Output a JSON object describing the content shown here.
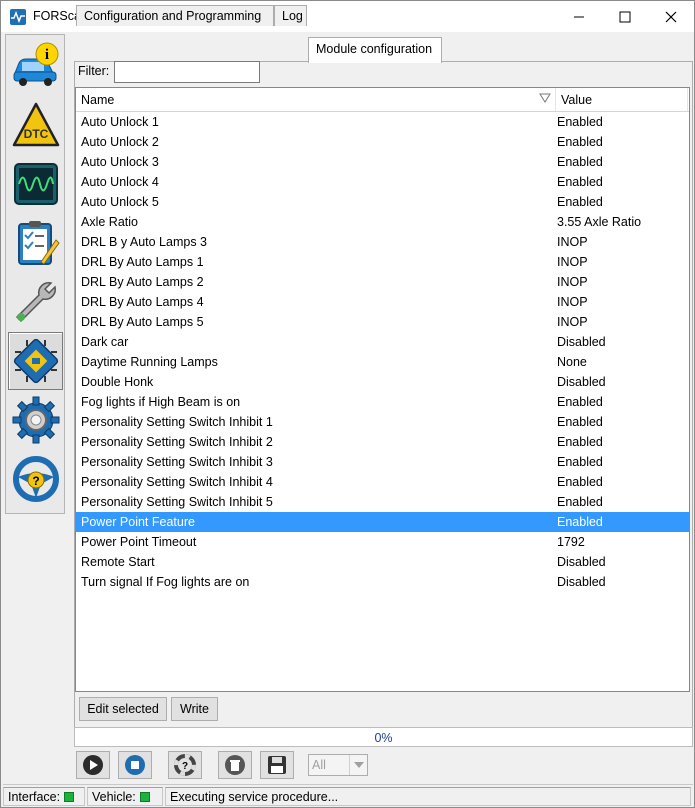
{
  "window": {
    "title": "FORScan",
    "controls": {
      "minimize": "—",
      "maximize": "☐",
      "close": "✕"
    }
  },
  "sidebar": {
    "items": [
      {
        "icon": "vehicle-info-icon"
      },
      {
        "icon": "dtc-icon",
        "text": "DTC"
      },
      {
        "icon": "oscilloscope-icon"
      },
      {
        "icon": "checklist-icon"
      },
      {
        "icon": "wrench-icon"
      },
      {
        "icon": "module-chip-icon",
        "active": true
      },
      {
        "icon": "settings-gear-icon"
      },
      {
        "icon": "help-steering-wheel-icon"
      }
    ]
  },
  "tabs": [
    {
      "label": "Configuration and Programming"
    },
    {
      "label": "Log"
    },
    {
      "label": "Module configuration",
      "active": true
    }
  ],
  "filter": {
    "label": "Filter:",
    "value": ""
  },
  "table": {
    "columns": {
      "name": "Name",
      "value": "Value"
    },
    "rows": [
      {
        "name": "Auto Unlock 1",
        "value": "Enabled"
      },
      {
        "name": "Auto Unlock 2",
        "value": "Enabled"
      },
      {
        "name": "Auto Unlock 3",
        "value": "Enabled"
      },
      {
        "name": "Auto Unlock 4",
        "value": "Enabled"
      },
      {
        "name": "Auto Unlock 5",
        "value": "Enabled"
      },
      {
        "name": "Axle Ratio",
        "value": "3.55 Axle Ratio"
      },
      {
        "name": "DRL B y Auto Lamps 3",
        "value": "INOP"
      },
      {
        "name": "DRL By Auto Lamps 1",
        "value": "INOP"
      },
      {
        "name": "DRL By Auto Lamps 2",
        "value": "INOP"
      },
      {
        "name": "DRL By Auto Lamps 4",
        "value": "INOP"
      },
      {
        "name": "DRL By Auto Lamps 5",
        "value": "INOP"
      },
      {
        "name": "Dark car",
        "value": "Disabled"
      },
      {
        "name": "Daytime Running Lamps",
        "value": "None"
      },
      {
        "name": "Double Honk",
        "value": "Disabled"
      },
      {
        "name": "Fog lights if High Beam is on",
        "value": "Enabled"
      },
      {
        "name": "Personality Setting Switch Inhibit 1",
        "value": "Enabled"
      },
      {
        "name": "Personality Setting Switch Inhibit 2",
        "value": "Enabled"
      },
      {
        "name": "Personality Setting Switch Inhibit 3",
        "value": "Enabled"
      },
      {
        "name": "Personality Setting Switch Inhibit 4",
        "value": "Enabled"
      },
      {
        "name": "Personality Setting Switch Inhibit 5",
        "value": "Enabled"
      },
      {
        "name": "Power Point Feature",
        "value": "Enabled",
        "selected": true
      },
      {
        "name": "Power Point Timeout",
        "value": "1792"
      },
      {
        "name": "Remote Start",
        "value": "Disabled"
      },
      {
        "name": "Turn signal If Fog lights are on",
        "value": "Disabled"
      }
    ]
  },
  "buttons": {
    "edit_selected": "Edit selected",
    "write": "Write"
  },
  "progress": {
    "value": 0,
    "text": "0%"
  },
  "toolbar": {
    "tools": [
      {
        "icon": "play-icon"
      },
      {
        "icon": "stop-icon"
      },
      {
        "icon": "help-lifebuoy-icon"
      },
      {
        "icon": "erase-icon"
      },
      {
        "icon": "save-icon"
      }
    ],
    "select": {
      "value": "All",
      "disabled": true
    }
  },
  "statusbar": {
    "interface_label": "Interface:",
    "vehicle_label": "Vehicle:",
    "status_text": "Executing service procedure...",
    "led_color": "#19b33e"
  }
}
